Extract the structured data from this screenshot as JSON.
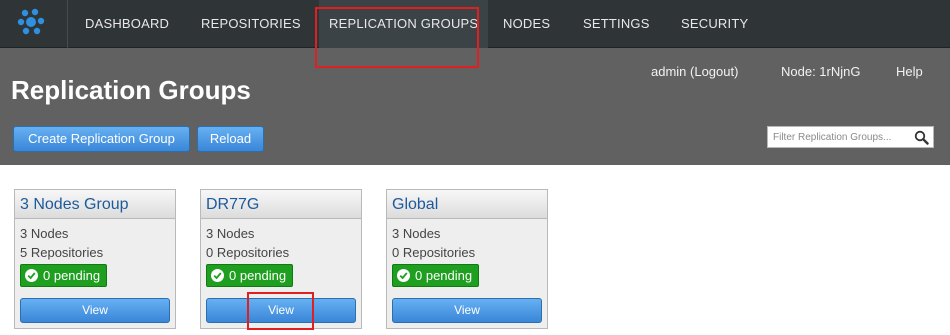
{
  "nav": {
    "logo_icon": "cluster-logo-icon",
    "items": [
      {
        "label": "DASHBOARD"
      },
      {
        "label": "REPOSITORIES"
      },
      {
        "label": "REPLICATION GROUPS"
      },
      {
        "label": "NODES"
      },
      {
        "label": "SETTINGS"
      },
      {
        "label": "SECURITY"
      }
    ],
    "active": "REPLICATION GROUPS"
  },
  "userbar": {
    "user": "admin (Logout)",
    "node": "Node: 1rNjnG",
    "help": "Help"
  },
  "page": {
    "title": "Replication Groups"
  },
  "toolbar": {
    "create_label": "Create Replication Group",
    "reload_label": "Reload",
    "filter_placeholder": "Filter Replication Groups...",
    "filter_icon": "search-icon"
  },
  "groups": [
    {
      "name": "3 Nodes Group",
      "nodes": "3 Nodes",
      "repositories": "5 Repositories",
      "pending": "0 pending",
      "view_label": "View"
    },
    {
      "name": "DR77G",
      "nodes": "3 Nodes",
      "repositories": "0 Repositories",
      "pending": "0 pending",
      "view_label": "View"
    },
    {
      "name": "Global",
      "nodes": "3 Nodes",
      "repositories": "0 Repositories",
      "pending": "0 pending",
      "view_label": "View"
    }
  ],
  "colors": {
    "nav_bg": "#2f3437",
    "header_bg": "#616161",
    "accent_blue": "#3a86d8",
    "pending_green": "#1f9f1f",
    "link_blue": "#1d5a9c",
    "highlight_red": "#e02020"
  }
}
